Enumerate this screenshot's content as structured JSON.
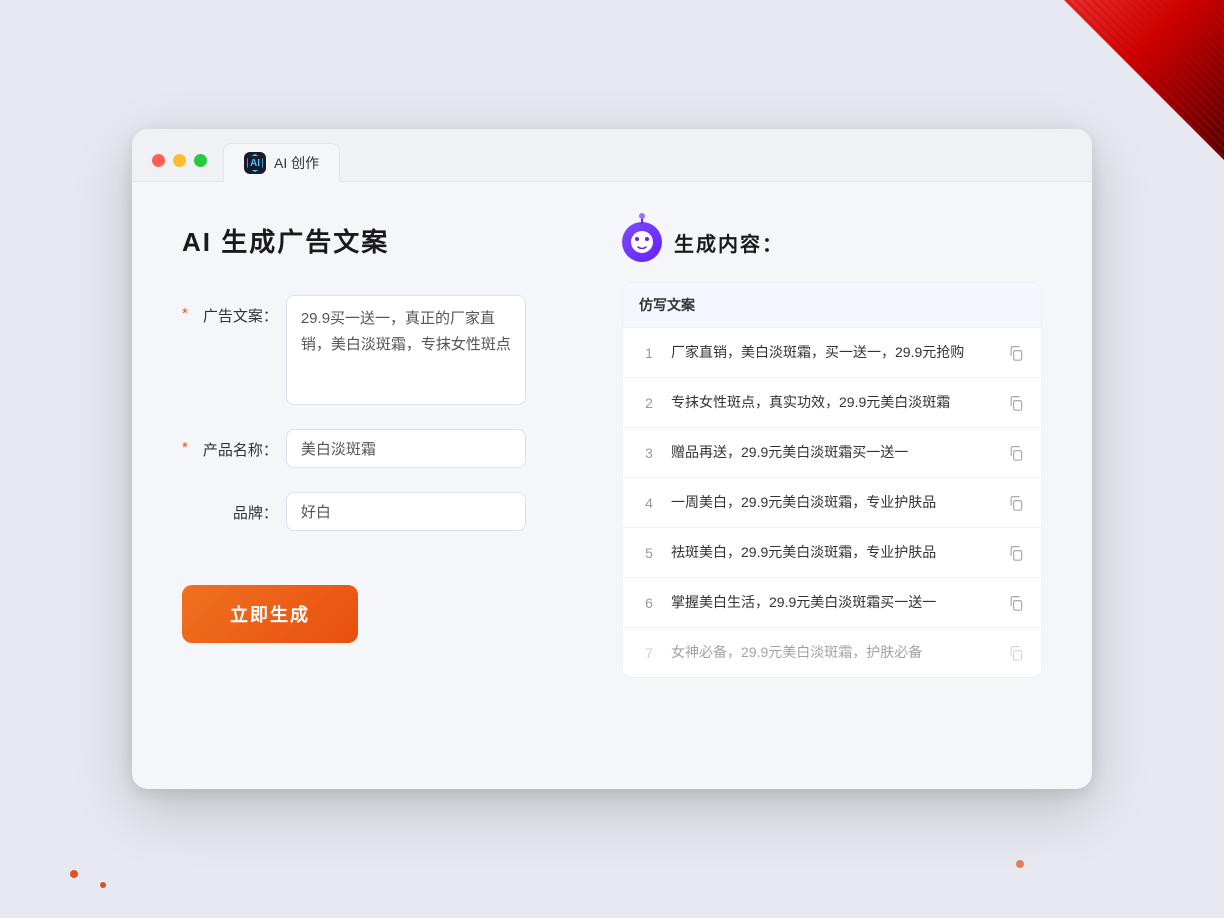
{
  "decorative": {
    "corner_label": "corner-decoration"
  },
  "browser": {
    "tab_icon_label": "AI",
    "tab_title": "AI 创作"
  },
  "page": {
    "title": "AI 生成广告文案"
  },
  "form": {
    "ad_copy_label": "广告文案：",
    "ad_copy_required": "*",
    "ad_copy_value": "29.9买一送一，真正的厂家直销，美白淡斑霜，专抹女性斑点",
    "product_name_label": "产品名称：",
    "product_name_required": "*",
    "product_name_value": "美白淡斑霜",
    "brand_label": "品牌：",
    "brand_value": "好白",
    "submit_label": "立即生成"
  },
  "output": {
    "title": "生成内容：",
    "table_header": "仿写文案",
    "results": [
      {
        "num": "1",
        "text": "厂家直销，美白淡斑霜，买一送一，29.9元抢购",
        "dimmed": false
      },
      {
        "num": "2",
        "text": "专抹女性斑点，真实功效，29.9元美白淡斑霜",
        "dimmed": false
      },
      {
        "num": "3",
        "text": "赠品再送，29.9元美白淡斑霜买一送一",
        "dimmed": false
      },
      {
        "num": "4",
        "text": "一周美白，29.9元美白淡斑霜，专业护肤品",
        "dimmed": false
      },
      {
        "num": "5",
        "text": "祛斑美白，29.9元美白淡斑霜，专业护肤品",
        "dimmed": false
      },
      {
        "num": "6",
        "text": "掌握美白生活，29.9元美白淡斑霜买一送一",
        "dimmed": false
      },
      {
        "num": "7",
        "text": "女神必备，29.9元美白淡斑霜，护肤必备",
        "dimmed": true
      }
    ]
  }
}
